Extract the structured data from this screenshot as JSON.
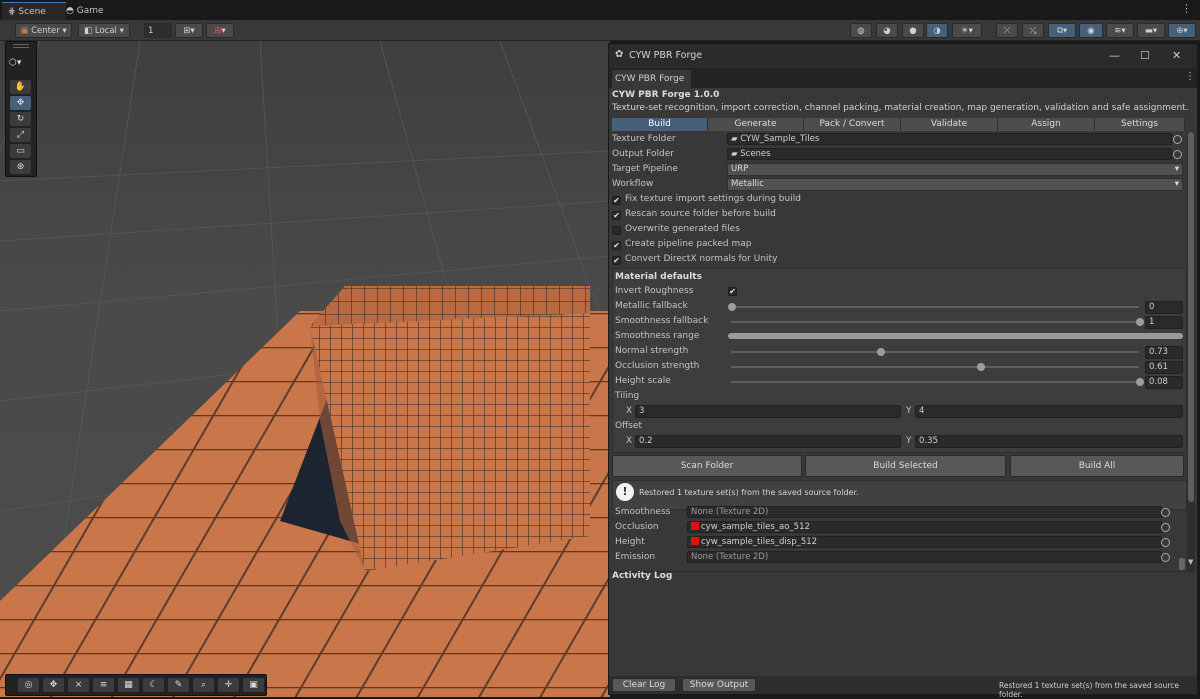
{
  "tabs": {
    "scene": "Scene",
    "game": "Game"
  },
  "scene_toolbar": {
    "pivot": "Center",
    "space": "Local",
    "grid_value": "1"
  },
  "window": {
    "title": "CYW PBR Forge",
    "tab": "CYW PBR Forge",
    "heading": "CYW PBR Forge 1.0.0",
    "description": "Texture-set recognition, import correction, channel packing, material creation, map generation, validation and safe assignment.",
    "tabs": [
      "Build",
      "Generate",
      "Pack / Convert",
      "Validate",
      "Assign",
      "Settings"
    ],
    "fields": {
      "texture_folder_label": "Texture Folder",
      "texture_folder": "CYW_Sample_Tiles",
      "output_folder_label": "Output Folder",
      "output_folder": "Scenes",
      "target_pipeline_label": "Target Pipeline",
      "target_pipeline": "URP",
      "workflow_label": "Workflow",
      "workflow": "Metallic"
    },
    "options": [
      {
        "label": "Fix texture import settings during build",
        "checked": true
      },
      {
        "label": "Rescan source folder before build",
        "checked": true
      },
      {
        "label": "Overwrite generated files",
        "checked": false
      },
      {
        "label": "Create pipeline packed map",
        "checked": true
      },
      {
        "label": "Convert DirectX normals for Unity",
        "checked": true
      }
    ],
    "material_defaults": {
      "heading": "Material defaults",
      "invert_roughness": {
        "label": "Invert Roughness",
        "checked": true
      },
      "sliders": [
        {
          "label": "Metallic fallback",
          "value": "0",
          "fraction": 0
        },
        {
          "label": "Smoothness fallback",
          "value": "1",
          "fraction": 1
        },
        {
          "label": "Normal strength",
          "value": "0.73",
          "fraction": 0.365
        },
        {
          "label": "Occlusion strength",
          "value": "0.61",
          "fraction": 0.61
        },
        {
          "label": "Height scale",
          "value": "0.08",
          "fraction": 1
        }
      ],
      "smoothness_range_label": "Smoothness range",
      "tiling": {
        "label": "Tiling",
        "x_label": "X",
        "x": "3",
        "y_label": "Y",
        "y": "4"
      },
      "offset": {
        "label": "Offset",
        "x_label": "X",
        "x": "0.2",
        "y_label": "Y",
        "y": "0.35"
      }
    },
    "buttons": {
      "scan": "Scan Folder",
      "build_selected": "Build Selected",
      "build_all": "Build All"
    },
    "notice": "Restored 1 texture set(s) from the saved source folder.",
    "maps": [
      {
        "label": "Smoothness",
        "value": "None (Texture 2D)",
        "swatch": false
      },
      {
        "label": "Occlusion",
        "value": "cyw_sample_tiles_ao_512",
        "swatch": true
      },
      {
        "label": "Height",
        "value": "cyw_sample_tiles_disp_512",
        "swatch": true
      },
      {
        "label": "Emission",
        "value": "None (Texture 2D)",
        "swatch": false
      }
    ],
    "activity_log": "Activity Log",
    "footer": {
      "clear": "Clear Log",
      "show_output": "Show Output",
      "status": "Restored 1 texture set(s) from the saved source folder."
    }
  },
  "colors": {
    "accent": "#46607c",
    "tile": "#c9774a",
    "swatch": "#e01010"
  }
}
